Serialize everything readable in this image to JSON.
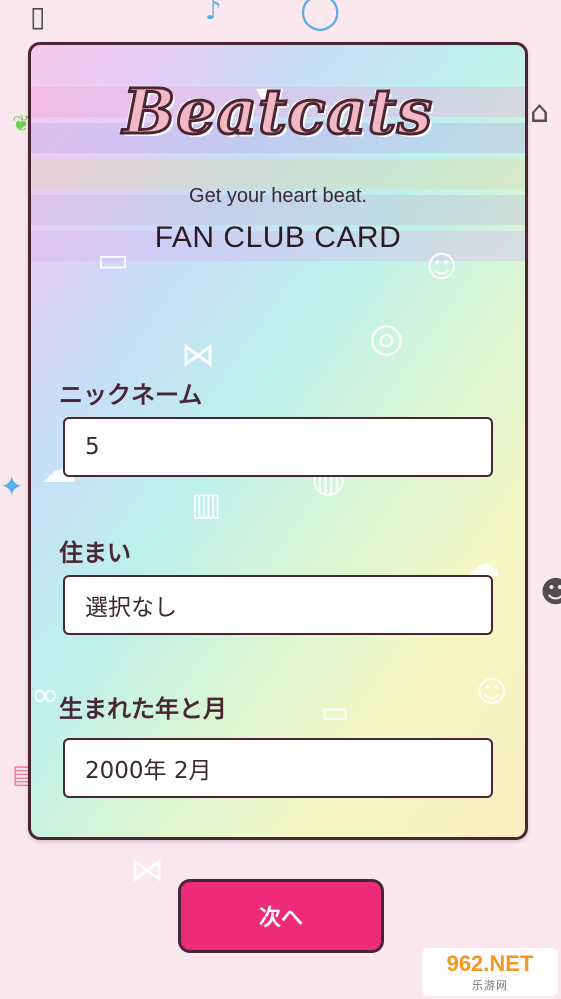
{
  "logo": "Beatcats",
  "tagline": "Get your heart beat.",
  "card_title": "FAN CLUB CARD",
  "nickname": {
    "label": "ニックネーム",
    "value": "5"
  },
  "residence": {
    "label": "住まい",
    "value": "選択なし"
  },
  "birth": {
    "label": "生まれた年と月",
    "value": "2000年 2月"
  },
  "next_button": "次へ",
  "watermark": {
    "main": "962.NET",
    "sub": "乐游网"
  },
  "colors": {
    "accent": "#ee2a7b",
    "border": "#4a2634",
    "logo_fill": "#f3b8c4"
  },
  "icons": [
    "ice-cream-icon",
    "vinyl-record-icon",
    "bow-icon",
    "cat-icon",
    "popsicle-icon"
  ]
}
